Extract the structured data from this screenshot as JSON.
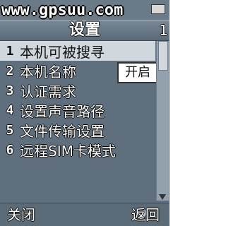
{
  "status": {
    "watermark": "www.gpsuu.com"
  },
  "header": {
    "title": "设置",
    "right_indicator": "1"
  },
  "menu": {
    "items": [
      {
        "number": "1",
        "label": "本机可被搜寻"
      },
      {
        "number": "2",
        "label": "本机名称"
      },
      {
        "number": "3",
        "label": "认证需求"
      },
      {
        "number": "4",
        "label": "设置声音路径"
      },
      {
        "number": "5",
        "label": "文件传输设置"
      },
      {
        "number": "6",
        "label": "远程SIM卡模式"
      }
    ],
    "selected_value": "开启"
  },
  "softkeys": {
    "left": "关闭",
    "right": "返回"
  },
  "icons": {
    "battery": "battery-icon",
    "scroll_up": "chevron-up-icon",
    "scroll_down": "chevron-down-icon",
    "logo": "zol-logo-icon"
  },
  "colors": {
    "background": "#5f6f7d",
    "selection": "#d0d8de"
  }
}
